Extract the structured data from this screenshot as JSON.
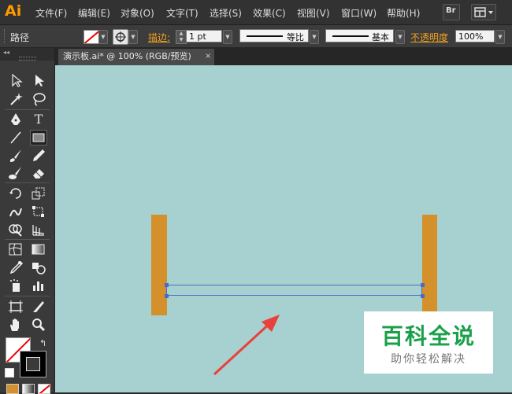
{
  "app": {
    "logo": "Ai"
  },
  "menu": {
    "items": [
      "文件(F)",
      "编辑(E)",
      "对象(O)",
      "文字(T)",
      "选择(S)",
      "效果(C)",
      "视图(V)",
      "窗口(W)",
      "帮助(H)"
    ],
    "br_label": "Br"
  },
  "control_bar": {
    "object_type": "路径",
    "stroke_label": "描边:",
    "stroke_weight": "1 pt",
    "profile_label": "等比",
    "brush_label": "基本",
    "opacity_label": "不透明度",
    "opacity_value": "100%"
  },
  "document": {
    "tab_title": "演示板.ai* @ 100% (RGB/预览)",
    "close_glyph": "×"
  },
  "toolbar": {
    "collapse_glyph": "◂◂",
    "tools": [
      "selection",
      "direct-selection",
      "magic-wand",
      "lasso",
      "pen",
      "type",
      "line",
      "rectangle",
      "paintbrush",
      "pencil",
      "blob-brush",
      "eraser",
      "rotate",
      "scale",
      "warp",
      "free-transform",
      "shape-builder",
      "perspective-grid",
      "mesh",
      "gradient",
      "eyedropper",
      "blend",
      "symbol-sprayer",
      "column-graph",
      "artboard",
      "slice",
      "hand",
      "zoom"
    ]
  },
  "watermark": {
    "title": "百科全说",
    "subtitle": "助你轻松解决"
  },
  "colors": {
    "canvas": "#a7d0d0",
    "post": "#d4902a",
    "selection": "#4a6cc8",
    "arrow": "#e8423a",
    "logo": "#ff9a00",
    "watermark_green": "#1aa04a"
  }
}
